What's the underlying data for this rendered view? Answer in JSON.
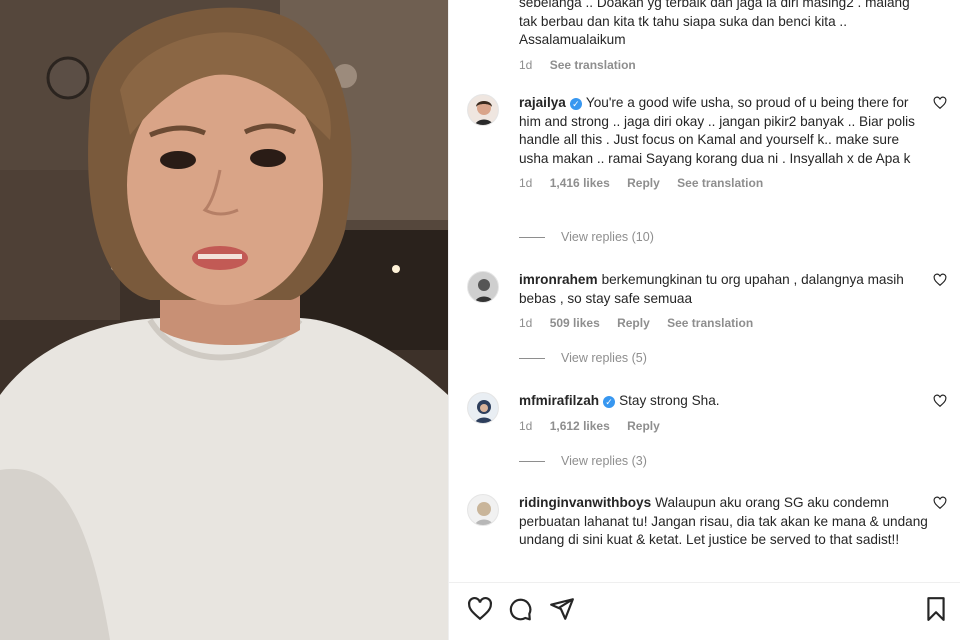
{
  "photo": {
    "alt": "woman selfie video"
  },
  "top_comment": {
    "text_line_1": "sebelanga .. Doakan yg terbaik dan jaga la diri masing2 . malang",
    "text_line_2": "tak berbau dan kita tk tahu siapa suka dan benci kita ..",
    "text_line_3": "Assalamualaikum",
    "time": "1d",
    "see_translation": "See translation"
  },
  "comments": [
    {
      "username": "rajailya",
      "verified": true,
      "text": "You're a good wife usha, so proud of u being there for him and strong .. jaga diri okay .. jangan pikir2 banyak .. Biar polis handle all this . Just focus on Kamal and yourself k.. make sure usha makan .. ramai Sayang korang dua ni . Insyallah x de Apa k",
      "time": "1d",
      "likes": "1,416 likes",
      "reply": "Reply",
      "see_translation": "See translation",
      "view_replies": "View replies (10)"
    },
    {
      "username": "imronrahem",
      "verified": false,
      "text": "berkemungkinan tu org upahan , dalangnya masih bebas , so stay safe semuaa",
      "time": "1d",
      "likes": "509 likes",
      "reply": "Reply",
      "see_translation": "See translation",
      "view_replies": "View replies (5)"
    },
    {
      "username": "mfmirafilzah",
      "verified": true,
      "text": "Stay strong Sha.",
      "time": "1d",
      "likes": "1,612 likes",
      "reply": "Reply",
      "view_replies": "View replies (3)"
    },
    {
      "username": "ridinginvanwithboys",
      "verified": false,
      "text": "Walaupun aku orang SG aku condemn perbuatan lahanat tu! Jangan risau, dia tak akan ke mana & undang undang di sini kuat & ketat. Let justice be served to that sadist!!"
    }
  ],
  "actions": {
    "like_icon": "heart-icon",
    "comment_icon": "comment-icon",
    "share_icon": "send-icon",
    "save_icon": "bookmark-icon"
  },
  "colors": {
    "text": "#262626",
    "muted": "#8e8e8e",
    "verified": "#3897f0"
  }
}
